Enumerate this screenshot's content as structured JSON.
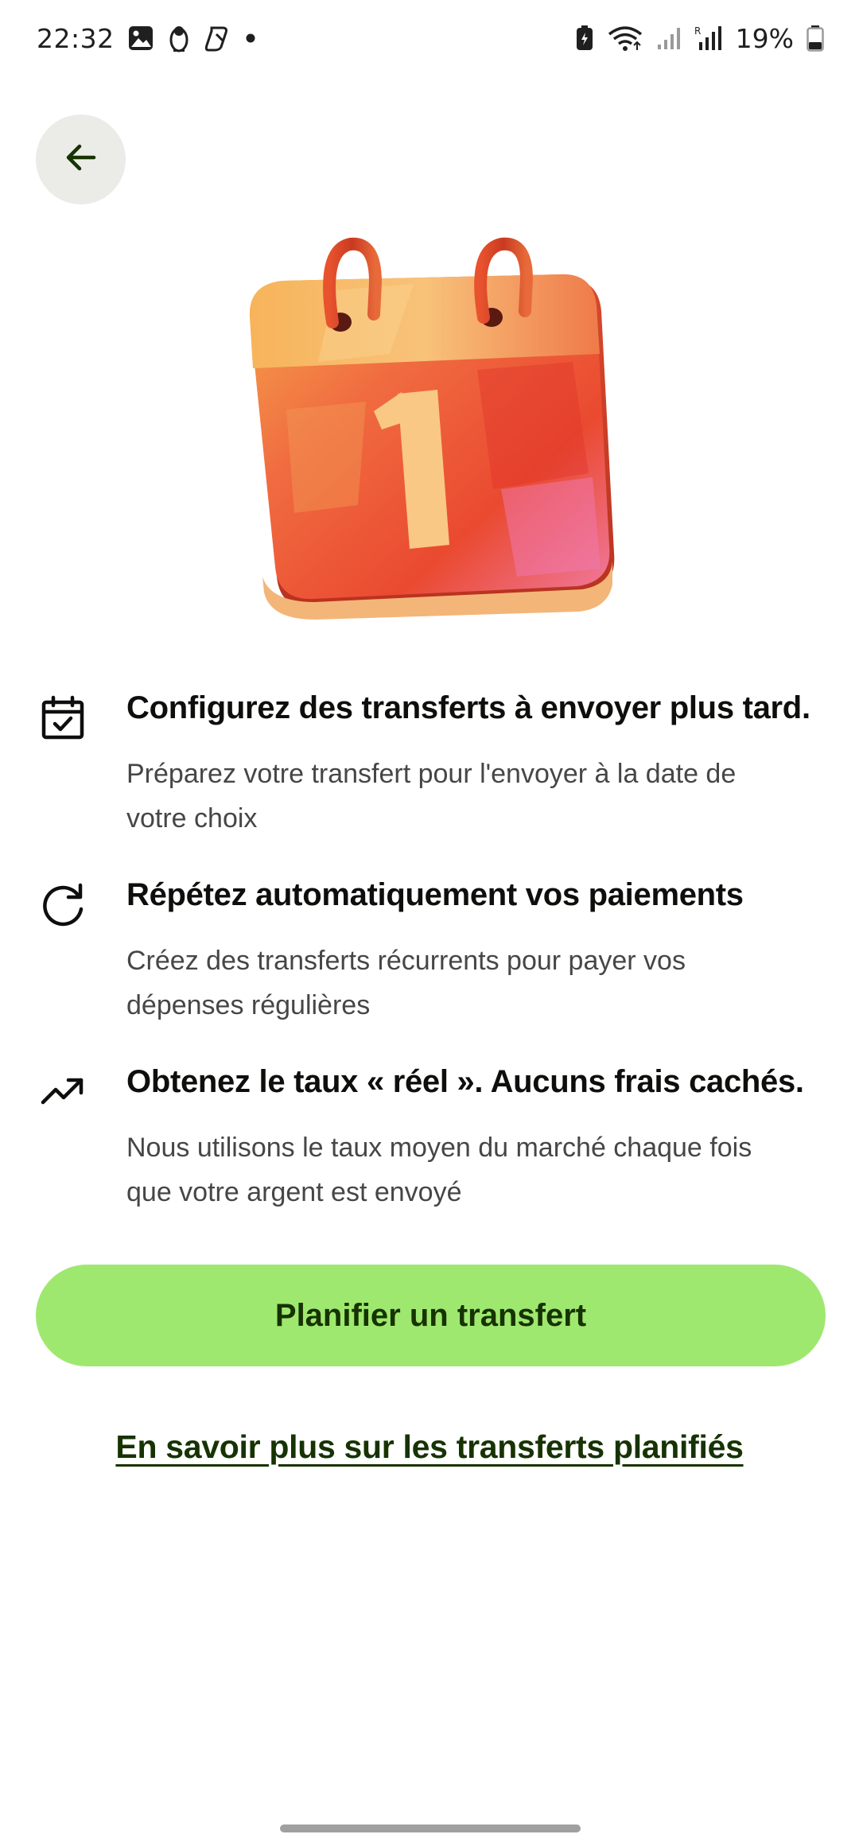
{
  "status_bar": {
    "time": "22:32",
    "battery": "19%",
    "icons": [
      "image-notification-icon",
      "penguin-notification-icon",
      "copilot-notification-icon",
      "dot-icon",
      "battery-saver-icon",
      "wifi-icon",
      "signal-icon",
      "roaming-signal-icon",
      "battery-icon"
    ]
  },
  "header": {
    "back_icon": "arrow-left-icon"
  },
  "illustration": {
    "name": "calendar-illustration",
    "colors": [
      "#f7a24a",
      "#ef5a3a",
      "#e8442e",
      "#f9c98a",
      "#c83a24"
    ]
  },
  "features": [
    {
      "icon": "calendar-check-icon",
      "title": "Configurez des transferts à envoyer plus tard.",
      "description_line1": "Préparez votre transfert pour l'envoyer à la date de",
      "description_line2": "votre choix"
    },
    {
      "icon": "refresh-icon",
      "title": "Répétez automatiquement vos paiements",
      "description_line1": "Créez des transferts récurrents pour payer vos",
      "description_line2": "dépenses régulières"
    },
    {
      "icon": "trending-up-icon",
      "title": "Obtenez le taux « réel ». Aucuns frais cachés.",
      "description_line1": "Nous utilisons le taux moyen du marché chaque fois",
      "description_line2": "que votre argent est envoyé"
    }
  ],
  "cta": {
    "label": "Planifier un transfert",
    "color": "#9fe870",
    "text_color": "#163300"
  },
  "link": {
    "label": "En savoir plus sur les transferts planifiés"
  }
}
